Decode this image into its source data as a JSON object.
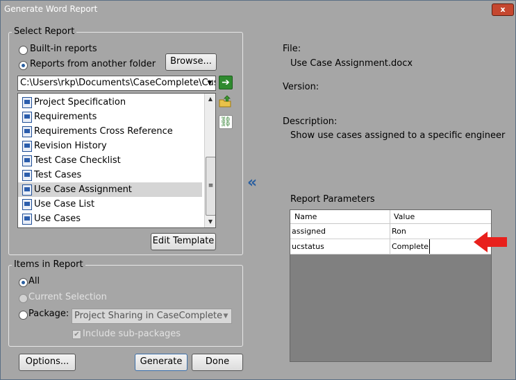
{
  "window": {
    "title": "Generate Word Report",
    "close_label": "x"
  },
  "select_report": {
    "legend": "Select Report",
    "radio_builtin": "Built-in reports",
    "radio_other": "Reports from another folder",
    "browse_label": "Browse...",
    "folder_path": "C:\\Users\\rkp\\Documents\\CaseComplete\\Cust",
    "reports": [
      "Project Specification",
      "Requirements",
      "Requirements Cross Reference",
      "Revision History",
      "Test Case Checklist",
      "Test Cases",
      "Use Case Assignment",
      "Use Case List",
      "Use Cases"
    ],
    "selected_report": "Use Case Assignment",
    "edit_template_label": "Edit Template"
  },
  "items_in_report": {
    "legend": "Items in Report",
    "radio_all": "All",
    "radio_current": "Current Selection",
    "radio_package": "Package:",
    "package_value": "Project Sharing in CaseComplete",
    "include_subpackages": "Include sub-packages"
  },
  "details": {
    "file_label": "File:",
    "file_value": "Use Case Assignment.docx",
    "version_label": "Version:",
    "description_label": "Description:",
    "description_value": "Show use cases assigned to a specific engineer",
    "collapse_glyph": "«"
  },
  "report_parameters": {
    "title": "Report Parameters",
    "col_name": "Name",
    "col_value": "Value",
    "rows": [
      {
        "name": "assigned",
        "value": "Ron"
      },
      {
        "name": "ucstatus",
        "value": "Complete"
      }
    ]
  },
  "buttons": {
    "options": "Options...",
    "generate": "Generate",
    "done": "Done"
  },
  "colors": {
    "annotation_arrow": "#e8201c",
    "accent_blue": "#2a5fa0"
  }
}
